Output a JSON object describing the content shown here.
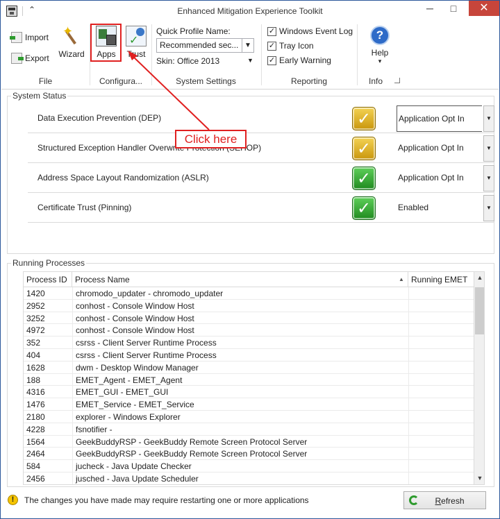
{
  "window": {
    "title": "Enhanced Mitigation Experience Toolkit",
    "minimize_glyph": "─",
    "maximize_glyph": "□",
    "close_glyph": "✕",
    "quick_access_caret": "⌃"
  },
  "ribbon": {
    "file_group": {
      "label": "File",
      "import_label": "Import",
      "export_label": "Export",
      "wizard_label": "Wizard"
    },
    "config_group": {
      "label": "Configura...",
      "apps_label": "Apps",
      "trust_label": "Trust"
    },
    "system_settings": {
      "label": "System Settings",
      "quick_profile_label": "Quick Profile Name:",
      "quick_profile_value": "Recommended sec...",
      "skin_label": "Skin: Office 2013"
    },
    "reporting": {
      "label": "Reporting",
      "options": [
        {
          "label": "Windows Event Log",
          "checked": true
        },
        {
          "label": "Tray Icon",
          "checked": true
        },
        {
          "label": "Early Warning",
          "checked": true
        }
      ]
    },
    "info": {
      "label": "Info",
      "help_label": "Help"
    }
  },
  "system_status": {
    "title": "System Status",
    "rows": [
      {
        "name": "Data Execution Prevention (DEP)",
        "status_color": "yellow",
        "value": "Application Opt In"
      },
      {
        "name": "Structured Exception Handler Overwrite Protection (SEHOP)",
        "status_color": "yellow",
        "value": "Application Opt In"
      },
      {
        "name": "Address Space Layout Randomization (ASLR)",
        "status_color": "green",
        "value": "Application Opt In"
      },
      {
        "name": "Certificate Trust (Pinning)",
        "status_color": "green",
        "value": "Enabled"
      }
    ]
  },
  "annotation": {
    "callout_text": "Click here",
    "color": "#e02020"
  },
  "running_processes": {
    "title": "Running Processes",
    "columns": [
      "Process ID",
      "Process Name",
      "Running EMET"
    ],
    "rows": [
      {
        "pid": "1420",
        "name": "chromodo_updater - chromodo_updater",
        "running": ""
      },
      {
        "pid": "2952",
        "name": "conhost - Console Window Host",
        "running": ""
      },
      {
        "pid": "3252",
        "name": "conhost - Console Window Host",
        "running": ""
      },
      {
        "pid": "4972",
        "name": "conhost - Console Window Host",
        "running": ""
      },
      {
        "pid": "352",
        "name": "csrss - Client Server Runtime Process",
        "running": ""
      },
      {
        "pid": "404",
        "name": "csrss - Client Server Runtime Process",
        "running": ""
      },
      {
        "pid": "1628",
        "name": "dwm - Desktop Window Manager",
        "running": ""
      },
      {
        "pid": "188",
        "name": "EMET_Agent - EMET_Agent",
        "running": ""
      },
      {
        "pid": "4316",
        "name": "EMET_GUI - EMET_GUI",
        "running": ""
      },
      {
        "pid": "1476",
        "name": "EMET_Service - EMET_Service",
        "running": ""
      },
      {
        "pid": "2180",
        "name": "explorer - Windows Explorer",
        "running": ""
      },
      {
        "pid": "4228",
        "name": "fsnotifier -",
        "running": ""
      },
      {
        "pid": "1564",
        "name": "GeekBuddyRSP - GeekBuddy Remote Screen Protocol Server",
        "running": ""
      },
      {
        "pid": "2464",
        "name": "GeekBuddyRSP - GeekBuddy Remote Screen Protocol Server",
        "running": ""
      },
      {
        "pid": "584",
        "name": "jucheck - Java Update Checker",
        "running": ""
      },
      {
        "pid": "2456",
        "name": "jusched - Java Update Scheduler",
        "running": ""
      }
    ]
  },
  "footer": {
    "warning_text": "The changes you have made may require restarting one or more applications",
    "refresh_label": "Refresh"
  },
  "colors": {
    "accent": "#2b579a",
    "close_button": "#c7453b",
    "highlight": "#e02020"
  }
}
